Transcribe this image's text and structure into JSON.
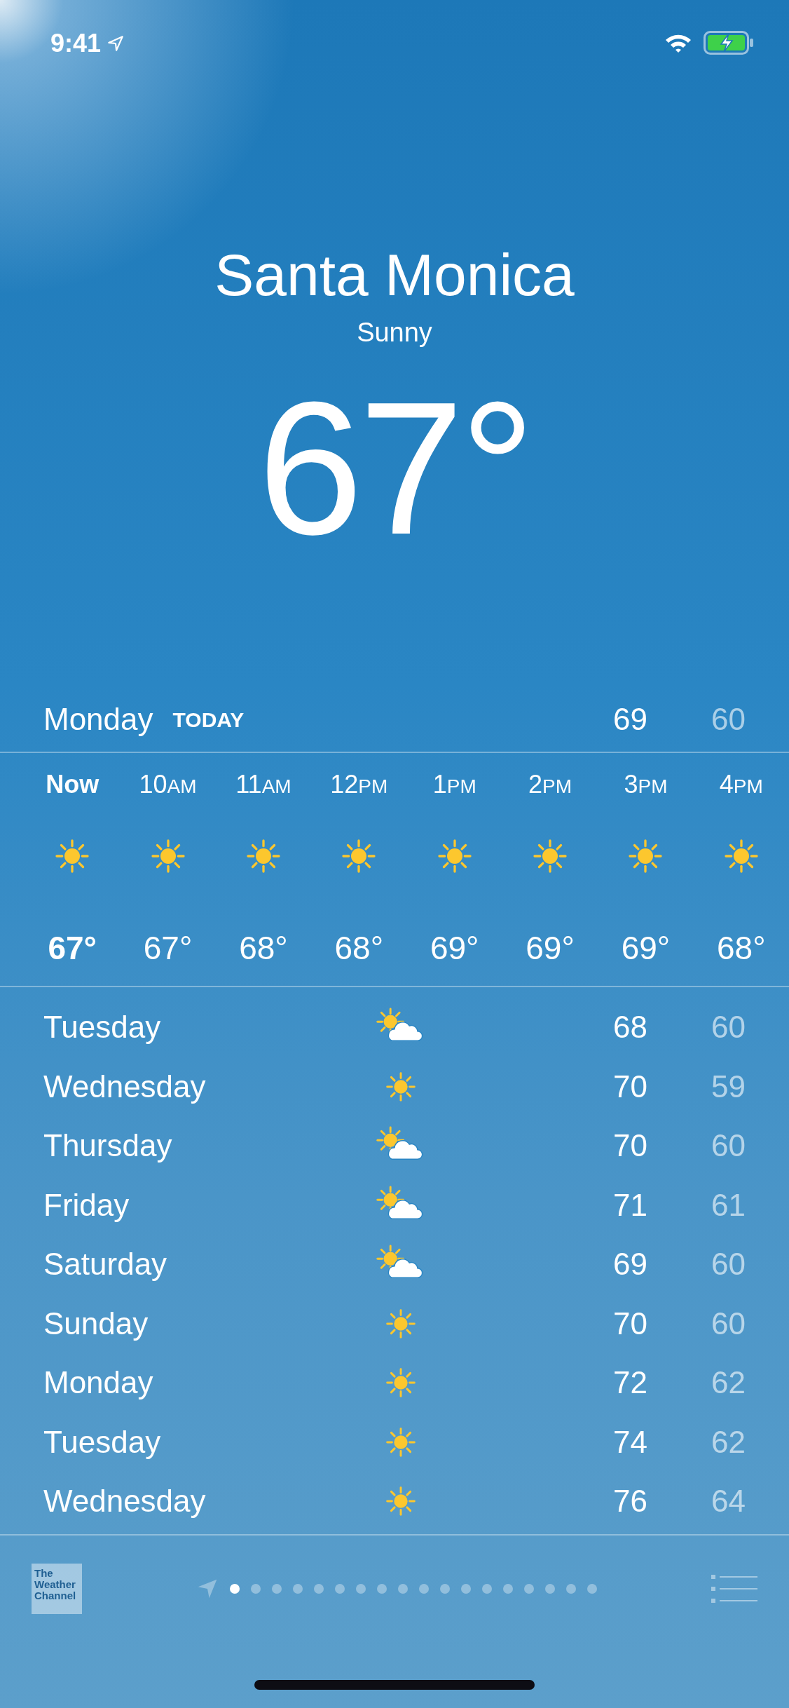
{
  "status_bar": {
    "time": "9:41"
  },
  "header": {
    "city": "Santa Monica",
    "condition": "Sunny",
    "temperature": "67°"
  },
  "today": {
    "day": "Monday",
    "label": "TODAY",
    "high": "69",
    "low": "60"
  },
  "hourly": [
    {
      "hour": "Now",
      "current": true,
      "kind": "sunny",
      "temp": "67°"
    },
    {
      "hour": "10",
      "period": "AM",
      "current": false,
      "kind": "sunny",
      "temp": "67°"
    },
    {
      "hour": "11",
      "period": "AM",
      "current": false,
      "kind": "sunny",
      "temp": "68°"
    },
    {
      "hour": "12",
      "period": "PM",
      "current": false,
      "kind": "sunny",
      "temp": "68°"
    },
    {
      "hour": "1",
      "period": "PM",
      "current": false,
      "kind": "sunny",
      "temp": "69°"
    },
    {
      "hour": "2",
      "period": "PM",
      "current": false,
      "kind": "sunny",
      "temp": "69°"
    },
    {
      "hour": "3",
      "period": "PM",
      "current": false,
      "kind": "sunny",
      "temp": "69°"
    },
    {
      "hour": "4",
      "period": "PM",
      "current": false,
      "kind": "sunny",
      "temp": "68°"
    }
  ],
  "daily": [
    {
      "day": "Tuesday",
      "kind": "partly-cloudy",
      "high": "68",
      "low": "60"
    },
    {
      "day": "Wednesday",
      "kind": "sunny",
      "high": "70",
      "low": "59"
    },
    {
      "day": "Thursday",
      "kind": "partly-cloudy",
      "high": "70",
      "low": "60"
    },
    {
      "day": "Friday",
      "kind": "partly-cloudy",
      "high": "71",
      "low": "61"
    },
    {
      "day": "Saturday",
      "kind": "partly-cloudy",
      "high": "69",
      "low": "60"
    },
    {
      "day": "Sunday",
      "kind": "sunny",
      "high": "70",
      "low": "60"
    },
    {
      "day": "Monday",
      "kind": "sunny",
      "high": "72",
      "low": "62"
    },
    {
      "day": "Tuesday",
      "kind": "sunny",
      "high": "74",
      "low": "62"
    },
    {
      "day": "Wednesday",
      "kind": "sunny",
      "high": "76",
      "low": "64"
    }
  ],
  "footer": {
    "logo": "The Weather Channel",
    "pages": [
      {
        "selected": true
      },
      {
        "selected": false
      },
      {
        "selected": false
      },
      {
        "selected": false
      },
      {
        "selected": false
      },
      {
        "selected": false
      },
      {
        "selected": false
      },
      {
        "selected": false
      },
      {
        "selected": false
      },
      {
        "selected": false
      },
      {
        "selected": false
      },
      {
        "selected": false
      },
      {
        "selected": false
      },
      {
        "selected": false
      },
      {
        "selected": false
      },
      {
        "selected": false
      },
      {
        "selected": false
      },
      {
        "selected": false
      }
    ]
  }
}
